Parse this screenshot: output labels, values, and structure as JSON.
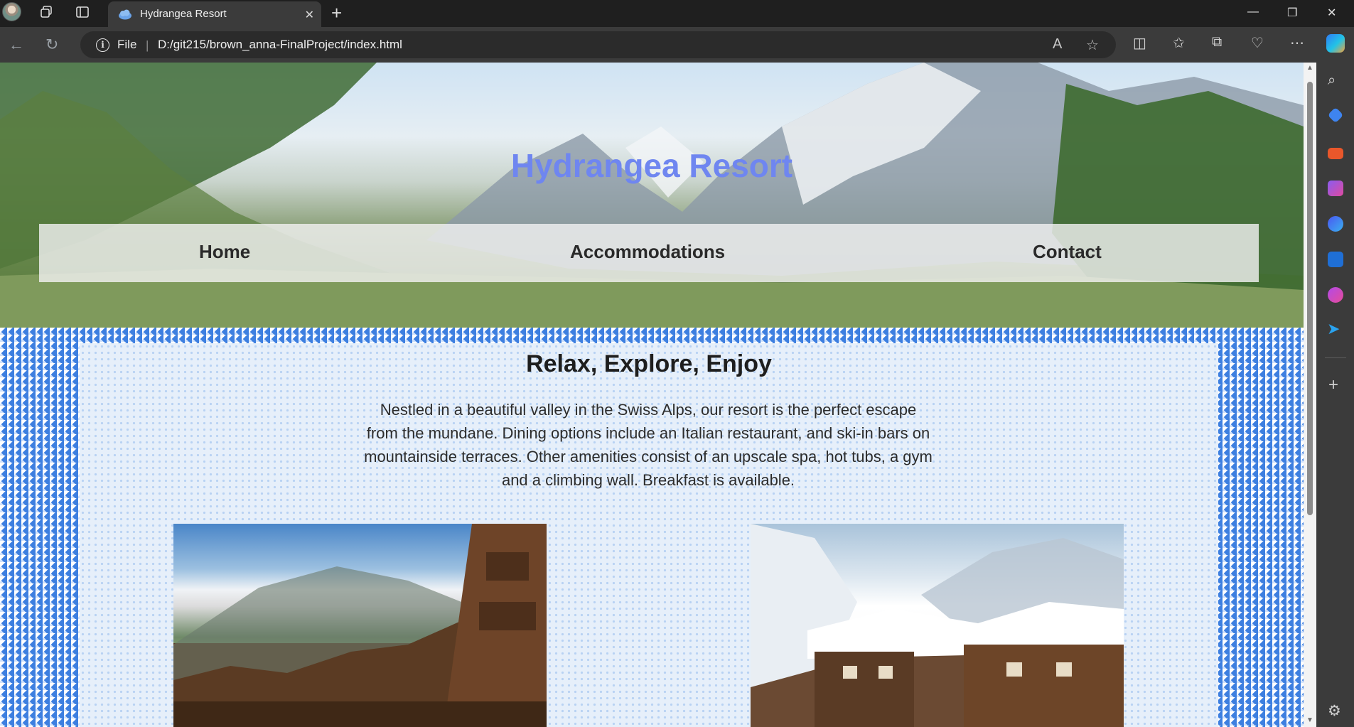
{
  "browser": {
    "tab_title": "Hydrangea Resort",
    "address": {
      "scheme_label": "File",
      "url": "D:/git215/brown_anna-FinalProject/index.html"
    }
  },
  "page": {
    "site_title": "Hydrangea Resort",
    "nav": [
      "Home",
      "Accommodations",
      "Contact"
    ],
    "heading": "Relax, Explore, Enjoy",
    "description": "Nestled in a beautiful valley in the Swiss Alps, our resort is the perfect escape from the mundane. Dining options include an Italian restaurant, and ski-in bars on mountainside terraces. Other amenities consist of an upscale spa, hot tubs, a gym and a climbing wall. Breakfast is available."
  },
  "colors": {
    "title": "#6f86f0",
    "pattern_blue": "#3d7fe0",
    "tab_active": "#3b3b3b"
  },
  "icons": [
    "back-icon",
    "refresh-icon",
    "info-icon",
    "read-aloud-icon",
    "favorite-star-icon",
    "split-screen-icon",
    "favorites-icon",
    "collections-icon",
    "heartbeat-icon",
    "more-icon",
    "copilot-icon",
    "search-icon",
    "tag-icon",
    "toolbox-icon",
    "games-icon",
    "shopping-icon",
    "outlook-icon",
    "designer-icon",
    "send-icon",
    "add-icon",
    "settings-icon"
  ]
}
